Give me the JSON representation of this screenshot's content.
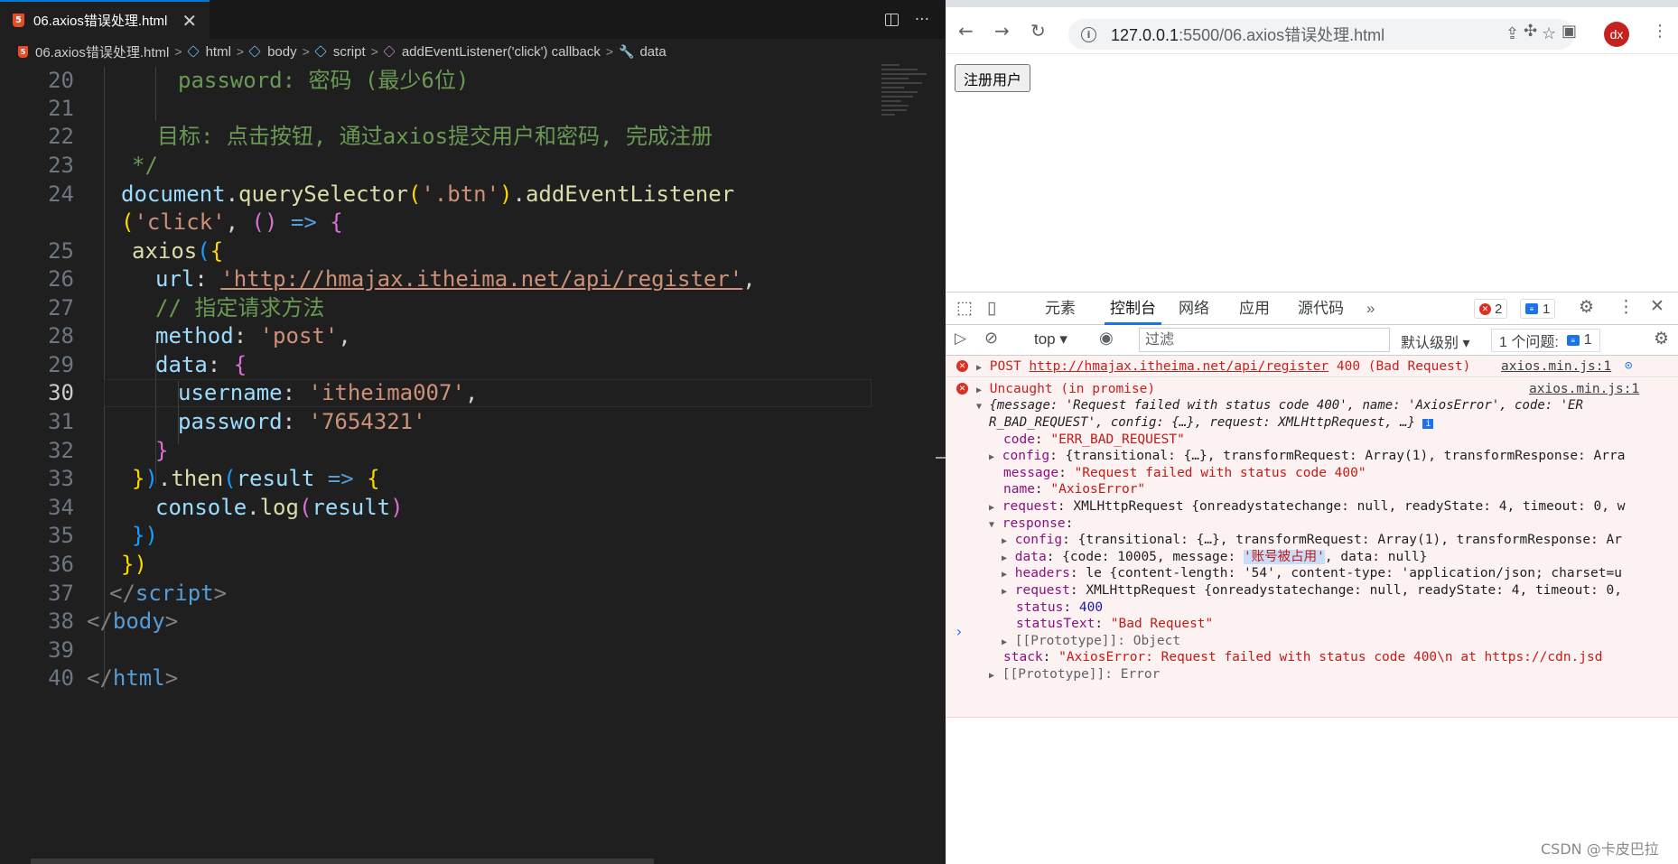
{
  "editor": {
    "tab_title": "06.axios错误处理.html",
    "tab_close": "✕",
    "more_actions": "···",
    "breadcrumb": {
      "file": "06.axios错误处理.html",
      "html": "html",
      "body": "body",
      "script": "script",
      "callback": "addEventListener('click') callback",
      "data": "data"
    },
    "line_numbers": [
      "20",
      "21",
      "22",
      "23",
      "24",
      "",
      "25",
      "26",
      "27",
      "28",
      "29",
      "30",
      "31",
      "32",
      "33",
      "34",
      "35",
      "36",
      "37",
      "38",
      "39",
      "40"
    ],
    "code": {
      "l20_key": "password",
      "l20_text": ": 密码 (最少6位)",
      "l22": "目标: 点击按钮, 通过axios提交用户和密码, 完成注册",
      "l23": "*/",
      "l24_obj": "document",
      "l24_dot1": ".",
      "l24_fn1": "querySelector",
      "l24_paren": "(",
      "l24_str": "'.btn'",
      "l24_paren2": ")",
      "l24_dot2": ".",
      "l24_fn2": "addEventListener",
      "l24b_paren": "(",
      "l24b_str": "'click'",
      "l24b_comma": ", ",
      "l24b_arrowp": "()",
      "l24b_arrow": " =>",
      "l24b_brace": " {",
      "l25_fn": "axios",
      "l25_p": "(",
      "l25_b": "{",
      "l26_key": "url",
      "l26_colon": ": ",
      "l26_str": "'http://hmajax.itheima.net/api/register'",
      "l26_comma": ",",
      "l27": "// 指定请求方法",
      "l28_key": "method",
      "l28_colon": ": ",
      "l28_str": "'post'",
      "l28_comma": ",",
      "l29_key": "data",
      "l29_colon": ": ",
      "l29_b": "{",
      "l30_key": "username",
      "l30_colon": ": ",
      "l30_str": "'itheima007'",
      "l30_comma": ",",
      "l31_key": "password",
      "l31_colon": ": ",
      "l31_str": "'7654321'",
      "l32": "}",
      "l33_b": "}",
      "l33_p": ")",
      "l33_dot": ".",
      "l33_fn": "then",
      "l33_p2": "(",
      "l33_arg": "result",
      "l33_arrow": " =>",
      "l33_brace": " {",
      "l34_obj": "console",
      "l34_dot": ".",
      "l34_fn": "log",
      "l34_p": "(",
      "l34_arg": "result",
      "l34_p2": ")",
      "l35": "})",
      "l36": "})",
      "l37_open": "</",
      "l37_tag": "script",
      "l37_close": ">",
      "l38_open": "</",
      "l38_tag": "body",
      "l38_close": ">",
      "l40_open": "</",
      "l40_tag": "html",
      "l40_close": ">"
    }
  },
  "browser": {
    "url_host": "127.0.0.1",
    "url_path": ":5500/06.axios错误处理.html",
    "avatar": "dx",
    "page_button": "注册用户",
    "devtools": {
      "tabs": [
        "元素",
        "控制台",
        "网络",
        "应用",
        "源代码"
      ],
      "more_tabs": "»",
      "error_count": "2",
      "message_count": "1",
      "context": "top",
      "filter_placeholder": "过滤",
      "level": "默认级别",
      "issues_label": "1 个问题:",
      "issues_count": "1",
      "console": {
        "post_method": "POST",
        "post_url": "http://hmajax.itheima.net/api/register",
        "post_status": "400 (Bad Request)",
        "post_source": "axios.min.js:1",
        "uncaught": "Uncaught (in promise)",
        "uncaught_source": "axios.min.js:1",
        "summary1": "{message: 'Request failed with status code 400', name: 'AxiosError', code: 'ER",
        "summary2": "R_BAD_REQUEST', config: {…}, request: XMLHttpRequest, …}",
        "code_key": "code",
        "code_val": "\"ERR_BAD_REQUEST\"",
        "config_key": "config",
        "config_val": "{transitional: {…}, transformRequest: Array(1), transformResponse: Arra",
        "message_key": "message",
        "message_val": "\"Request failed with status code 400\"",
        "name_key": "name",
        "name_val": "\"AxiosError\"",
        "request_key": "request",
        "request_val": "XMLHttpRequest {onreadystatechange: null, readyState: 4, timeout: 0, w",
        "response_key": "response",
        "r_config_key": "config",
        "r_config_val": "{transitional: {…}, transformRequest: Array(1), transformResponse: Ar",
        "r_data_key": "data",
        "r_data_pre": "{code: 10005, message: ",
        "r_data_msg": "'账号被占用'",
        "r_data_post": ", data: null}",
        "r_headers_key": "headers",
        "r_headers_val": "le {content-length: '54', content-type: 'application/json; charset=u",
        "r_request_key": "request",
        "r_request_val": "XMLHttpRequest {onreadystatechange: null, readyState: 4, timeout: 0,",
        "r_status_key": "status",
        "r_status_val": "400",
        "r_statustext_key": "statusText",
        "r_statustext_val": "\"Bad Request\"",
        "r_proto": "[[Prototype]]: Object",
        "stack_key": "stack",
        "stack_val": "\"AxiosError: Request failed with status code 400\\n    at https://cdn.jsd",
        "proto": "[[Prototype]]: Error",
        "prompt": "›"
      }
    }
  },
  "watermark": "CSDN @卡皮巴拉"
}
